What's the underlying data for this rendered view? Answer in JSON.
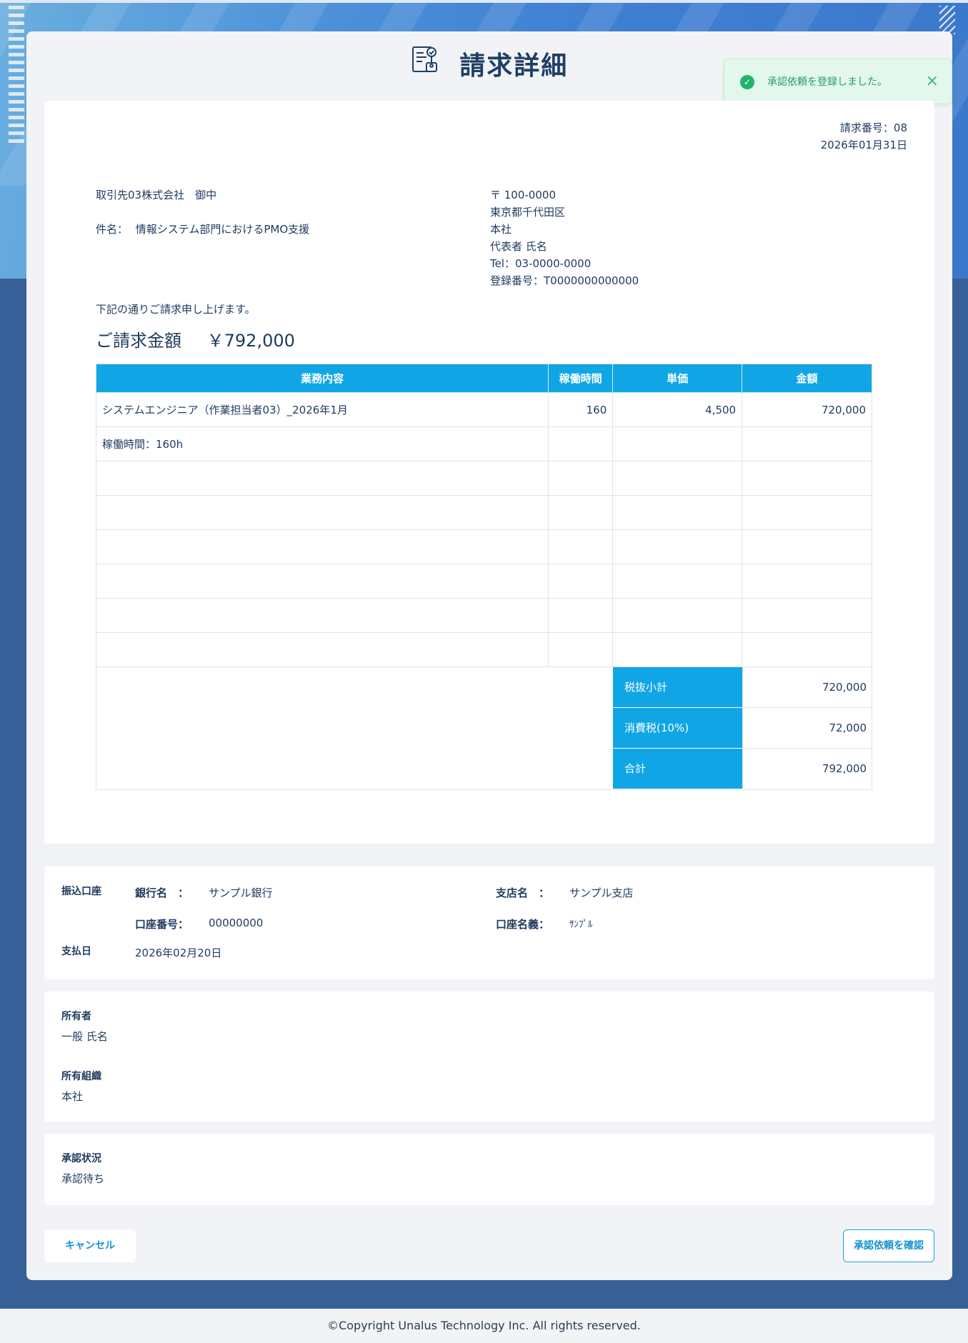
{
  "page": {
    "title": "請求詳細",
    "title_icon": "invoice-document-icon"
  },
  "toast": {
    "icon": "check-circle-icon",
    "message": "承認依頼を登録しました。",
    "close_icon": "close-icon",
    "color": "#23a067"
  },
  "invoice": {
    "number": "請求番号：08",
    "date": "2026年01月31日",
    "client": "取引先03株式会社　御中",
    "subject_label": "件名：",
    "subject": "情報システム部門におけるPMO支援",
    "sender": {
      "postal": "〒 100-0000",
      "address": "東京都千代田区",
      "branch": "本社",
      "representative": "代表者 氏名",
      "tel": "Tel：03-0000-0000",
      "registration": "登録番号：T0000000000000"
    },
    "intro": "下記の通りご請求申し上げます。",
    "total_label": "ご請求金額",
    "total_amount": "￥792,000",
    "columns": [
      "業務内容",
      "稼働時間",
      "単価",
      "金額"
    ],
    "rows": [
      [
        "システムエンジニア（作業担当者03）_2026年1月",
        "160",
        "4,500",
        "720,000"
      ],
      [
        "稼働時間：160h",
        "",
        "",
        ""
      ],
      [
        "",
        "",
        "",
        ""
      ],
      [
        "",
        "",
        "",
        ""
      ],
      [
        "",
        "",
        "",
        ""
      ],
      [
        "",
        "",
        "",
        ""
      ],
      [
        "",
        "",
        "",
        ""
      ],
      [
        "",
        "",
        "",
        ""
      ]
    ],
    "summary": [
      {
        "label": "税抜小計",
        "value": "720,000"
      },
      {
        "label": "消費税(10%)",
        "value": "72,000"
      },
      {
        "label": "合計",
        "value": "792,000"
      }
    ],
    "header_color": "#10a6e6"
  },
  "bank": {
    "section_label": "振込口座",
    "bank_name_label": "銀行名　：",
    "bank_name": "サンプル銀行",
    "branch_label": "支店名　：",
    "branch": "サンプル支店",
    "account_no_label": "口座番号：",
    "account_no": "00000000",
    "account_name_label": "口座名義：",
    "account_name": "ｻﾝﾌﾟﾙ",
    "pay_date_label": "支払日",
    "pay_date": "2026年02月20日"
  },
  "owner": {
    "owner_label": "所有者",
    "owner": "一般 氏名",
    "org_label": "所有組織",
    "org": "本社"
  },
  "approval": {
    "label": "承認状況",
    "value": "承認待ち"
  },
  "buttons": {
    "cancel": "キャンセル",
    "confirm": "承認依頼を確認"
  },
  "footer": "©Copyright Unalus Technology Inc. All rights reserved."
}
